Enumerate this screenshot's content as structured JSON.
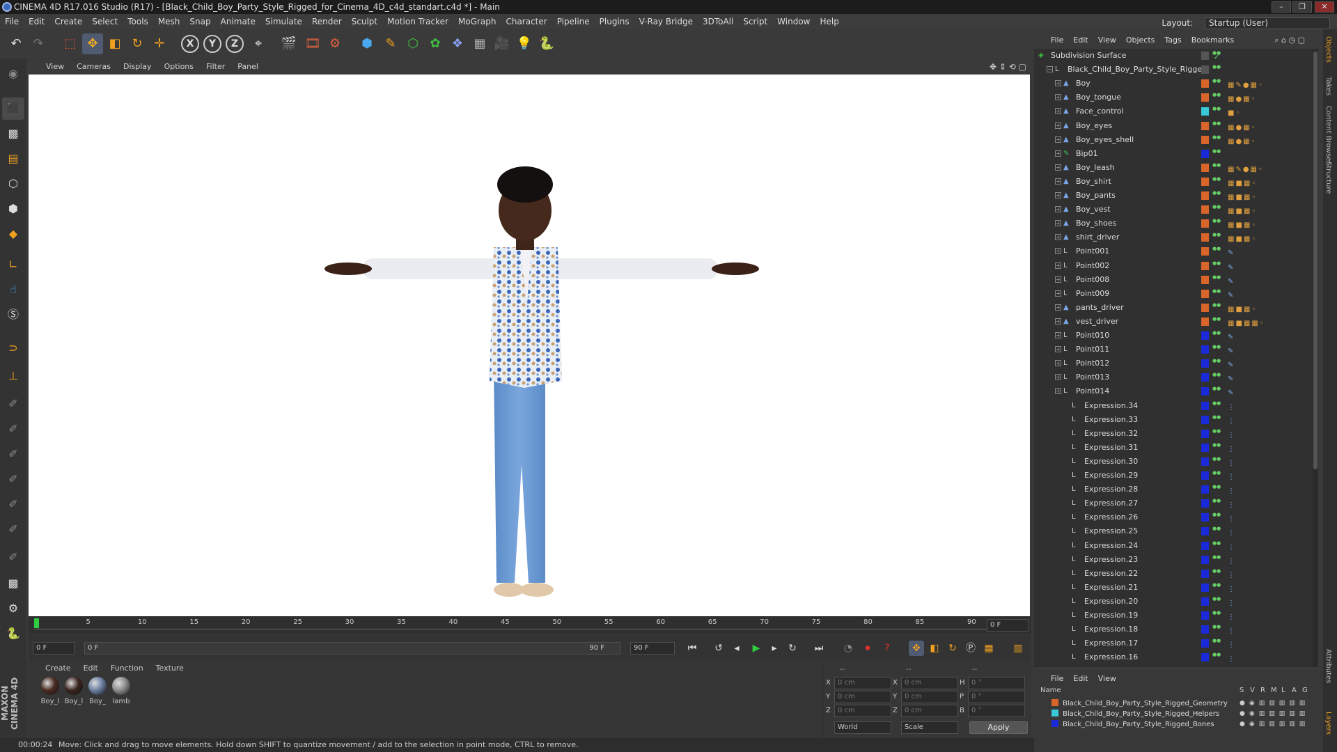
{
  "window": {
    "title": "CINEMA 4D R17.016 Studio (R17) - [Black_Child_Boy_Party_Style_Rigged_for_Cinema_4D_c4d_standart.c4d *] - Main"
  },
  "menubar": {
    "items": [
      "File",
      "Edit",
      "Create",
      "Select",
      "Tools",
      "Mesh",
      "Snap",
      "Animate",
      "Simulate",
      "Render",
      "Sculpt",
      "Motion Tracker",
      "MoGraph",
      "Character",
      "Pipeline",
      "Plugins",
      "V-Ray Bridge",
      "3DToAll",
      "Script",
      "Window",
      "Help"
    ],
    "layout_label": "Layout:",
    "layout_value": "Startup (User)"
  },
  "viewport": {
    "menu": [
      "View",
      "Cameras",
      "Display",
      "Options",
      "Filter",
      "Panel"
    ]
  },
  "timeline": {
    "ticks": [
      "0",
      "5",
      "10",
      "15",
      "20",
      "25",
      "30",
      "35",
      "40",
      "45",
      "50",
      "55",
      "60",
      "65",
      "70",
      "75",
      "80",
      "85",
      "90"
    ],
    "current_frame_display": "0 F"
  },
  "playback": {
    "start_field": "0 F",
    "slider_start": "0 F",
    "slider_end": "90 F",
    "end_field": "90 F"
  },
  "materials": {
    "menu": [
      "Create",
      "Edit",
      "Function",
      "Texture"
    ],
    "items": [
      {
        "label": "Boy_l",
        "color": "#4a2a22"
      },
      {
        "label": "Boy_l",
        "color": "#3a241e"
      },
      {
        "label": "Boy_",
        "color": "#6a7ea0"
      },
      {
        "label": "lamb",
        "color": "#8a8a8a"
      }
    ]
  },
  "coordinates": {
    "header": [
      "--",
      "--",
      "--"
    ],
    "rows": [
      {
        "a": "X",
        "av": "0 cm",
        "b": "X",
        "bv": "0 cm",
        "c": "H",
        "cv": "0 °"
      },
      {
        "a": "Y",
        "av": "0 cm",
        "b": "Y",
        "bv": "0 cm",
        "c": "P",
        "cv": "0 °"
      },
      {
        "a": "Z",
        "av": "0 cm",
        "b": "Z",
        "bv": "0 cm",
        "c": "B",
        "cv": "0 °"
      }
    ],
    "world": "World",
    "scale": "Scale",
    "apply": "Apply"
  },
  "status": {
    "time": "00:00:24",
    "message": "Move: Click and drag to move elements. Hold down SHIFT to quantize movement / add to the selection in point mode, CTRL to remove."
  },
  "objects": {
    "menu": [
      "File",
      "Edit",
      "View",
      "Objects",
      "Tags",
      "Bookmarks"
    ],
    "rows": [
      {
        "name": "Subdivision Surface",
        "indent": 0,
        "layer": "",
        "type": "sub",
        "tags": ""
      },
      {
        "name": "Black_Child_Boy_Party_Style_Rigged",
        "indent": 1,
        "layer": "",
        "type": "null",
        "tags": ""
      },
      {
        "name": "Boy",
        "indent": 2,
        "layer": "#d8662a",
        "type": "poly",
        "tags": "▦✎●▦◦"
      },
      {
        "name": "Boy_tongue",
        "indent": 2,
        "layer": "#d8662a",
        "type": "poly",
        "tags": "▦●▦◦"
      },
      {
        "name": "Face_control",
        "indent": 2,
        "layer": "#38c8d8",
        "type": "poly",
        "tags": "■◦"
      },
      {
        "name": "Boy_eyes",
        "indent": 2,
        "layer": "#d8662a",
        "type": "poly",
        "tags": "▦●▦◦"
      },
      {
        "name": "Boy_eyes_shell",
        "indent": 2,
        "layer": "#d8662a",
        "type": "poly",
        "tags": "▦●▦◦"
      },
      {
        "name": "Bip01",
        "indent": 2,
        "layer": "#1a2ad8",
        "type": "bone",
        "tags": ""
      },
      {
        "name": "Boy_leash",
        "indent": 2,
        "layer": "#d8662a",
        "type": "poly",
        "tags": "▦✎●▦◦"
      },
      {
        "name": "Boy_shirt",
        "indent": 2,
        "layer": "#d8662a",
        "type": "poly",
        "tags": "▦■▦◦"
      },
      {
        "name": "Boy_pants",
        "indent": 2,
        "layer": "#d8662a",
        "type": "poly",
        "tags": "▦■▦◦"
      },
      {
        "name": "Boy_vest",
        "indent": 2,
        "layer": "#d8662a",
        "type": "poly",
        "tags": "▦■▦◦"
      },
      {
        "name": "Boy_shoes",
        "indent": 2,
        "layer": "#d8662a",
        "type": "poly",
        "tags": "▦■▦◦"
      },
      {
        "name": "shirt_driver",
        "indent": 2,
        "layer": "#d8662a",
        "type": "poly",
        "tags": "▦■▦◦"
      },
      {
        "name": "Point001",
        "indent": 2,
        "layer": "#d8662a",
        "type": "null",
        "tags": "✎"
      },
      {
        "name": "Point002",
        "indent": 2,
        "layer": "#d8662a",
        "type": "null",
        "tags": "✎"
      },
      {
        "name": "Point008",
        "indent": 2,
        "layer": "#d8662a",
        "type": "null",
        "tags": "✎"
      },
      {
        "name": "Point009",
        "indent": 2,
        "layer": "#d8662a",
        "type": "null",
        "tags": "✎"
      },
      {
        "name": "pants_driver",
        "indent": 2,
        "layer": "#d8662a",
        "type": "poly",
        "tags": "▦■▦◦"
      },
      {
        "name": "vest_driver",
        "indent": 2,
        "layer": "#d8662a",
        "type": "poly",
        "tags": "▦■▦▦◦"
      },
      {
        "name": "Point010",
        "indent": 2,
        "layer": "#1a2ad8",
        "type": "null",
        "tags": "✎"
      },
      {
        "name": "Point011",
        "indent": 2,
        "layer": "#1a2ad8",
        "type": "null",
        "tags": "✎"
      },
      {
        "name": "Point012",
        "indent": 2,
        "layer": "#1a2ad8",
        "type": "null",
        "tags": "✎"
      },
      {
        "name": "Point013",
        "indent": 2,
        "layer": "#1a2ad8",
        "type": "null",
        "tags": "✎"
      },
      {
        "name": "Point014",
        "indent": 2,
        "layer": "#1a2ad8",
        "type": "null",
        "tags": "✎"
      },
      {
        "name": "Expression.34",
        "indent": 3,
        "layer": "#1a2ad8",
        "type": "null",
        "tags": "⋮"
      },
      {
        "name": "Expression.33",
        "indent": 3,
        "layer": "#1a2ad8",
        "type": "null",
        "tags": "⋮"
      },
      {
        "name": "Expression.32",
        "indent": 3,
        "layer": "#1a2ad8",
        "type": "null",
        "tags": "⋮"
      },
      {
        "name": "Expression.31",
        "indent": 3,
        "layer": "#1a2ad8",
        "type": "null",
        "tags": "⋮"
      },
      {
        "name": "Expression.30",
        "indent": 3,
        "layer": "#1a2ad8",
        "type": "null",
        "tags": "⋮"
      },
      {
        "name": "Expression.29",
        "indent": 3,
        "layer": "#1a2ad8",
        "type": "null",
        "tags": "⋮"
      },
      {
        "name": "Expression.28",
        "indent": 3,
        "layer": "#1a2ad8",
        "type": "null",
        "tags": "⋮"
      },
      {
        "name": "Expression.27",
        "indent": 3,
        "layer": "#1a2ad8",
        "type": "null",
        "tags": "⋮"
      },
      {
        "name": "Expression.26",
        "indent": 3,
        "layer": "#1a2ad8",
        "type": "null",
        "tags": "⋮"
      },
      {
        "name": "Expression.25",
        "indent": 3,
        "layer": "#1a2ad8",
        "type": "null",
        "tags": "⋮"
      },
      {
        "name": "Expression.24",
        "indent": 3,
        "layer": "#1a2ad8",
        "type": "null",
        "tags": "⋮"
      },
      {
        "name": "Expression.23",
        "indent": 3,
        "layer": "#1a2ad8",
        "type": "null",
        "tags": "⋮"
      },
      {
        "name": "Expression.22",
        "indent": 3,
        "layer": "#1a2ad8",
        "type": "null",
        "tags": "⋮"
      },
      {
        "name": "Expression.21",
        "indent": 3,
        "layer": "#1a2ad8",
        "type": "null",
        "tags": "⋮"
      },
      {
        "name": "Expression.20",
        "indent": 3,
        "layer": "#1a2ad8",
        "type": "null",
        "tags": "⋮"
      },
      {
        "name": "Expression.19",
        "indent": 3,
        "layer": "#1a2ad8",
        "type": "null",
        "tags": "⋮"
      },
      {
        "name": "Expression.18",
        "indent": 3,
        "layer": "#1a2ad8",
        "type": "null",
        "tags": "⋮"
      },
      {
        "name": "Expression.17",
        "indent": 3,
        "layer": "#1a2ad8",
        "type": "null",
        "tags": "⋮"
      },
      {
        "name": "Expression.16",
        "indent": 3,
        "layer": "#1a2ad8",
        "type": "null",
        "tags": "⋮"
      }
    ]
  },
  "layers": {
    "menu": [
      "File",
      "Edit",
      "View"
    ],
    "columns": [
      "S",
      "V",
      "R",
      "M",
      "L",
      "A",
      "G"
    ],
    "name_header": "Name",
    "rows": [
      {
        "name": "Black_Child_Boy_Party_Style_Rigged_Geometry",
        "color": "#d8662a"
      },
      {
        "name": "Black_Child_Boy_Party_Style_Rigged_Helpers",
        "color": "#38c8d8"
      },
      {
        "name": "Black_Child_Boy_Party_Style_Rigged_Bones",
        "color": "#1a2ad8"
      }
    ]
  },
  "side_tabs": [
    "Objects",
    "Takes",
    "Content Browser",
    "Structure",
    "Attributes",
    "Layers"
  ],
  "brand": "MAXON CINEMA 4D"
}
